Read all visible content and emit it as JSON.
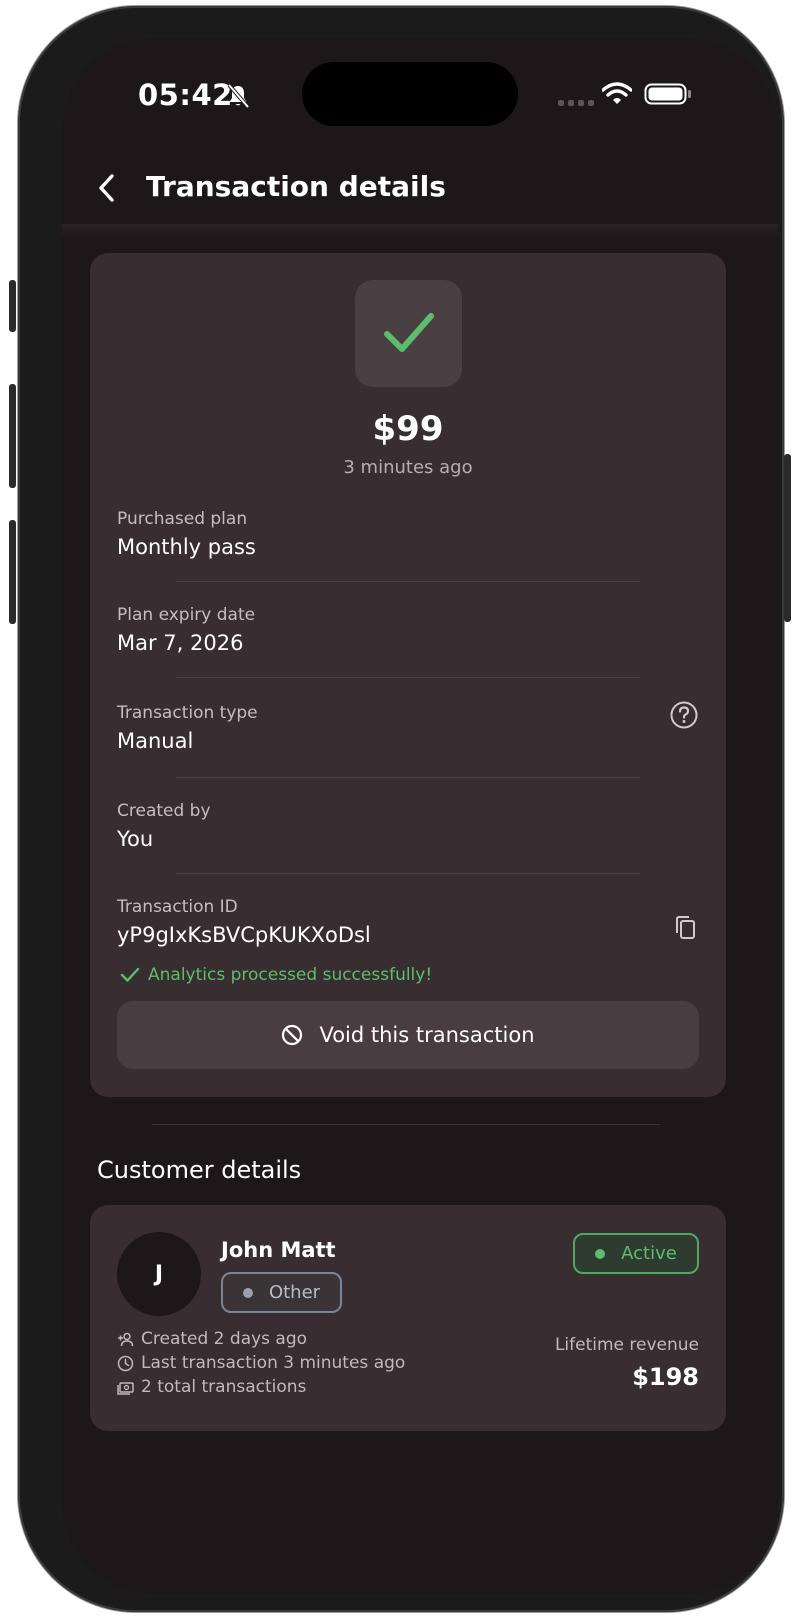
{
  "status_bar": {
    "time": "05:42"
  },
  "header": {
    "title": "Transaction details"
  },
  "transaction": {
    "amount": "$99",
    "time_ago": "3 minutes ago",
    "fields": {
      "plan": {
        "label": "Purchased plan",
        "value": "Monthly pass"
      },
      "expiry": {
        "label": "Plan expiry date",
        "value": "Mar 7, 2026"
      },
      "type": {
        "label": "Transaction type",
        "value": "Manual"
      },
      "created_by": {
        "label": "Created by",
        "value": "You"
      },
      "id": {
        "label": "Transaction ID",
        "value": "yP9gIxKsBVCpKUKXoDsl"
      }
    },
    "analytics_status": "Analytics processed successfully!",
    "void_label": "Void this transaction"
  },
  "customer": {
    "section_title": "Customer details",
    "avatar_initial": "J",
    "name": "John Matt",
    "type_badge": "Other",
    "status_badge": "Active",
    "created": "Created 2 days ago",
    "last_transaction": "Last transaction 3 minutes ago",
    "total_transactions": "2 total transactions",
    "lifetime_revenue_label": "Lifetime revenue",
    "lifetime_revenue": "$198"
  },
  "colors": {
    "background": "#1e1719",
    "card": "#382e31",
    "success": "#5cbd6c",
    "neutral_badge": "#7c8594"
  },
  "icons": {
    "status": "check-icon",
    "back": "chevron-left-icon",
    "help": "question-circle-icon",
    "copy": "copy-icon",
    "void": "block-icon"
  }
}
